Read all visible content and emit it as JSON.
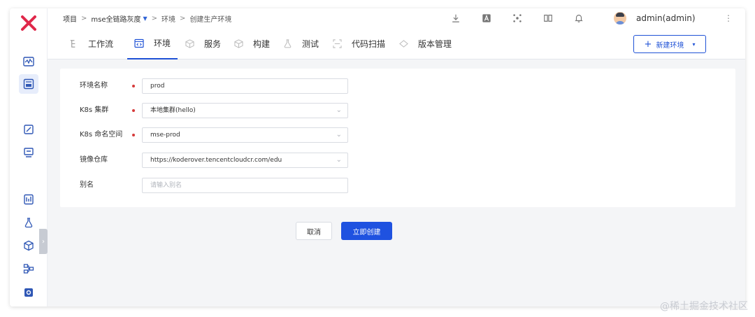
{
  "breadcrumb": {
    "root": "项目",
    "project": "mse全链路灰度",
    "section": "环境",
    "current": "创建生产环境",
    "separator": ">"
  },
  "user": {
    "name": "admin(admin)"
  },
  "tabs": [
    {
      "label": "工作流",
      "icon": "workflow-icon"
    },
    {
      "label": "环境",
      "icon": "environment-icon",
      "active": true
    },
    {
      "label": "服务",
      "icon": "service-icon"
    },
    {
      "label": "构建",
      "icon": "build-icon"
    },
    {
      "label": "测试",
      "icon": "test-icon"
    },
    {
      "label": "代码扫描",
      "icon": "code-scan-icon"
    },
    {
      "label": "版本管理",
      "icon": "version-icon"
    }
  ],
  "new_env_button": {
    "label": "新建环境",
    "plus": "+",
    "caret": "▾"
  },
  "form": {
    "env_name": {
      "label": "环境名称",
      "value": "prod"
    },
    "cluster": {
      "label": "K8s 集群",
      "value": "本地集群(hello)"
    },
    "namespace": {
      "label": "K8s 命名空间",
      "value": "mse-prod"
    },
    "registry": {
      "label": "镜像仓库",
      "value": "https://koderover.tencentcloudcr.com/edu"
    },
    "alias": {
      "label": "别名",
      "placeholder": "请输入别名"
    }
  },
  "actions": {
    "cancel": "取消",
    "create": "立即创建"
  },
  "watermark": "@稀土掘金技术社区",
  "colors": {
    "primary": "#1f52e0",
    "required": "#d63b3b",
    "logo": "#e0284a"
  }
}
